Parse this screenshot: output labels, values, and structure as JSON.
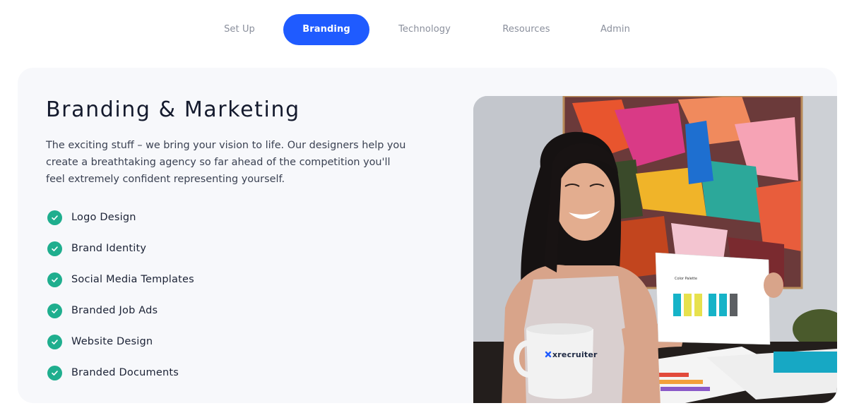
{
  "nav": {
    "tabs": [
      {
        "label": "Set Up",
        "active": false
      },
      {
        "label": "Branding",
        "active": true
      },
      {
        "label": "Technology",
        "active": false
      },
      {
        "label": "Resources",
        "active": false
      },
      {
        "label": "Admin",
        "active": false
      }
    ]
  },
  "section": {
    "title": "Branding & Marketing",
    "description": "The exciting stuff – we bring your vision to life. Our designers help you create a breathtaking agency so far ahead of the competition you'll feel extremely confident representing yourself.",
    "features": [
      "Logo Design",
      "Brand Identity",
      "Social Media Templates",
      "Branded Job Ads",
      "Website Design",
      "Branded Documents"
    ]
  },
  "photo": {
    "mug_brand": "xrecruiter",
    "paper_heading": "Color Palette"
  },
  "colors": {
    "accent": "#1f5bff",
    "check": "#1fae8e",
    "card_bg": "#f7f8fb",
    "muted_tab": "#8a8f9c"
  },
  "icons": {
    "feature_icon": "check-circle-icon"
  }
}
